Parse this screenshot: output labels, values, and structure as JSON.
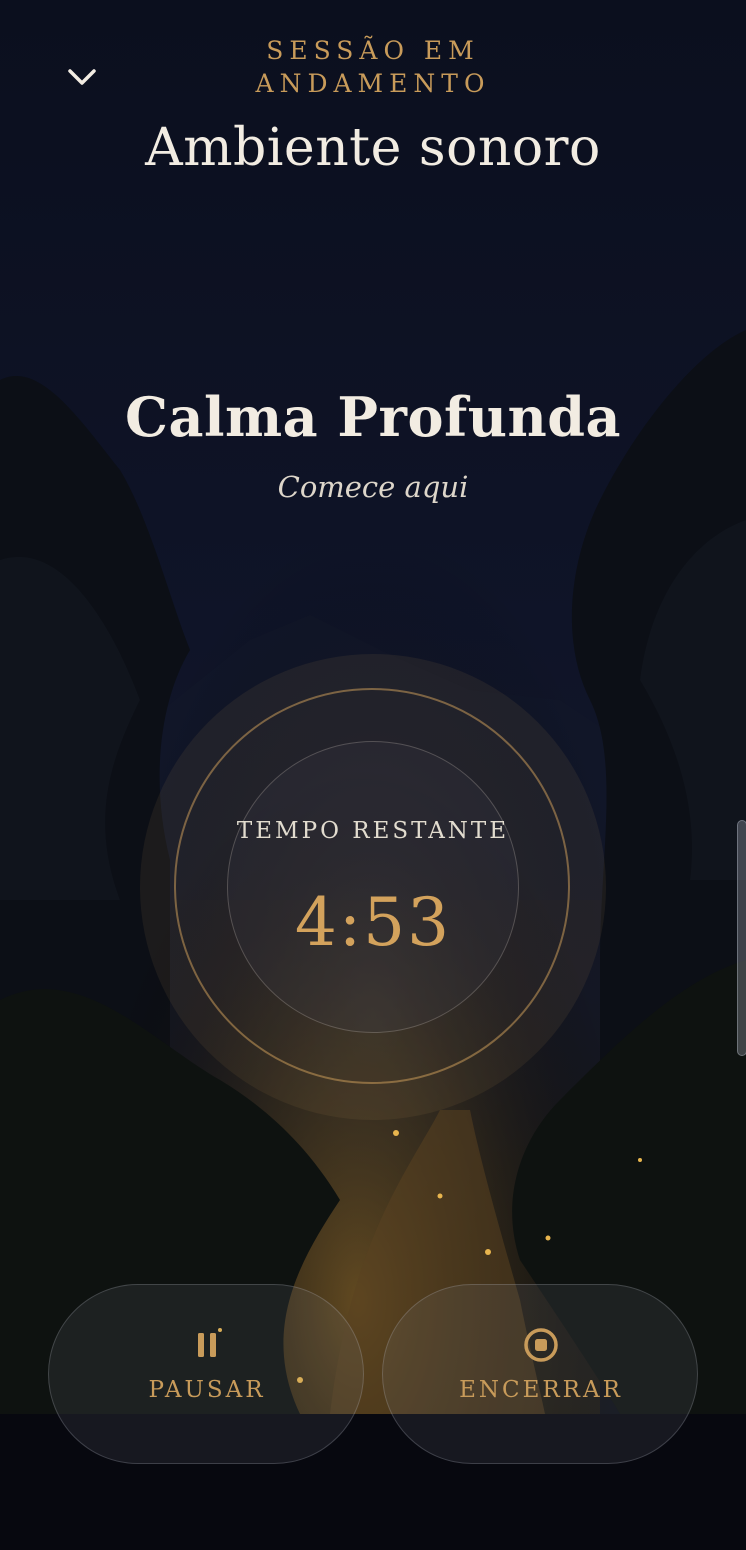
{
  "header": {
    "overline": "SESSÃO EM ANDAMENTO",
    "title": "Ambiente sonoro",
    "collapse_icon": "chevron-down-icon"
  },
  "track": {
    "name": "Calma Profunda",
    "subtitle": "Comece aqui"
  },
  "timer": {
    "label": "TEMPO RESTANTE",
    "value": "4:53"
  },
  "controls": {
    "pause": {
      "label": "PAUSAR",
      "icon": "pause-icon"
    },
    "end": {
      "label": "ENCERRAR",
      "icon": "stop-circle-icon"
    }
  },
  "colors": {
    "accent": "#c89b5a",
    "timer": "#d3a25c",
    "text": "#f2ece2",
    "background": "#07080f"
  }
}
